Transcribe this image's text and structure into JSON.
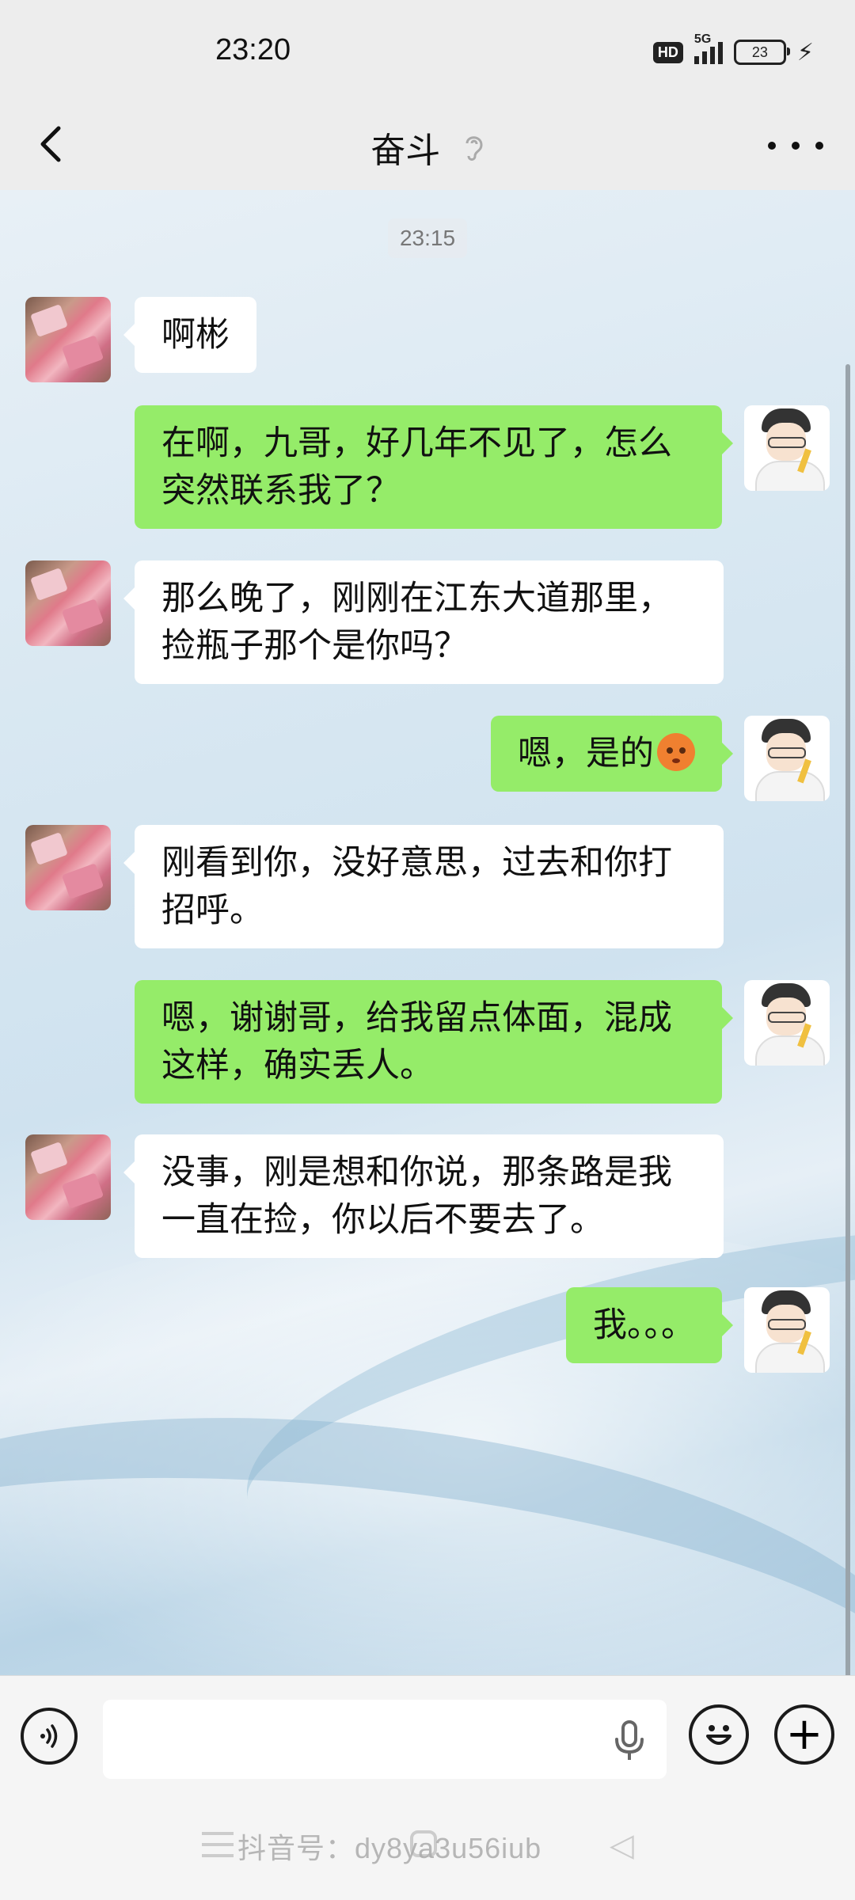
{
  "status_bar": {
    "time": "23:20",
    "hd_badge": "HD",
    "network": "5G",
    "battery": "23"
  },
  "header": {
    "title": "奋斗",
    "ear_icon": "ear-icon"
  },
  "chat": {
    "timestamp": "23:15",
    "messages": [
      {
        "side": "left",
        "text": "啊彬"
      },
      {
        "side": "right",
        "text": "在啊，九哥，好几年不见了，怎么突然联系我了？"
      },
      {
        "side": "left",
        "text": "那么晚了，刚刚在江东大道那里，捡瓶子那个是你吗？"
      },
      {
        "side": "right",
        "text": "嗯，是的",
        "emoji": "sweat-emoji"
      },
      {
        "side": "left",
        "text": "刚看到你，没好意思，过去和你打招呼。"
      },
      {
        "side": "right",
        "text": "嗯，谢谢哥，给我留点体面，混成这样，确实丢人。"
      },
      {
        "side": "left",
        "text": "没事，刚是想和你说，那条路是我一直在捡，你以后不要去了。"
      },
      {
        "side": "right",
        "text": "我。。。"
      }
    ]
  },
  "input_bar": {
    "placeholder": "",
    "plus_symbol": "+"
  },
  "watermark": "抖音号：dy8ya3u56iub",
  "colors": {
    "sent_bubble": "#95ec69",
    "received_bubble": "#ffffff",
    "header_bg": "#ededed"
  }
}
